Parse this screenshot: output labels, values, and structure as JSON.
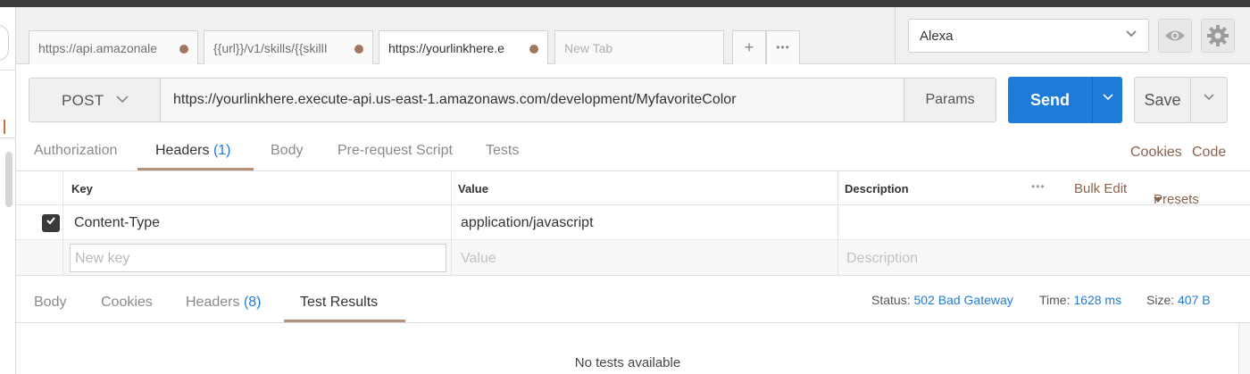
{
  "request_tabs": [
    {
      "label": "https://api.amazonale",
      "active": false
    },
    {
      "label": "{{url}}/v1/skills/{{skillI",
      "active": false
    },
    {
      "label": "https://yourlinkhere.e",
      "active": true
    },
    {
      "label": "New Tab",
      "active": false
    }
  ],
  "tab_actions": {
    "add": "+",
    "more": "•••"
  },
  "environment": {
    "selected": "Alexa"
  },
  "request": {
    "method": "POST",
    "url": "https://yourlinkhere.execute-api.us-east-1.amazonaws.com/development/MyfavoriteColor",
    "params_label": "Params",
    "send_label": "Send",
    "save_label": "Save"
  },
  "request_subtabs": {
    "authorization": "Authorization",
    "headers": "Headers",
    "headers_count": "(1)",
    "body": "Body",
    "prerequest": "Pre-request Script",
    "tests": "Tests",
    "cookies_link": "Cookies",
    "code_link": "Code"
  },
  "headers_table": {
    "columns": {
      "key": "Key",
      "value": "Value",
      "description": "Description"
    },
    "more": "•••",
    "bulk_edit": "Bulk Edit",
    "presets": "Presets",
    "rows": [
      {
        "checked": true,
        "key": "Content-Type",
        "value": "application/javascript",
        "description": ""
      }
    ],
    "placeholders": {
      "key": "New key",
      "value": "Value",
      "description": "Description"
    }
  },
  "response_tabs": {
    "body": "Body",
    "cookies": "Cookies",
    "headers": "Headers",
    "headers_count": "(8)",
    "test_results": "Test Results"
  },
  "response_status": {
    "status_label": "Status:",
    "status_value": "502 Bad Gateway",
    "time_label": "Time:",
    "time_value": "1628 ms",
    "size_label": "Size:",
    "size_value": "407 B"
  },
  "test_results": {
    "empty_message": "No tests available"
  },
  "colors": {
    "accent_blue": "#1f7bd8",
    "tab_underline": "#b5917a",
    "link_brown": "#8a6350"
  }
}
